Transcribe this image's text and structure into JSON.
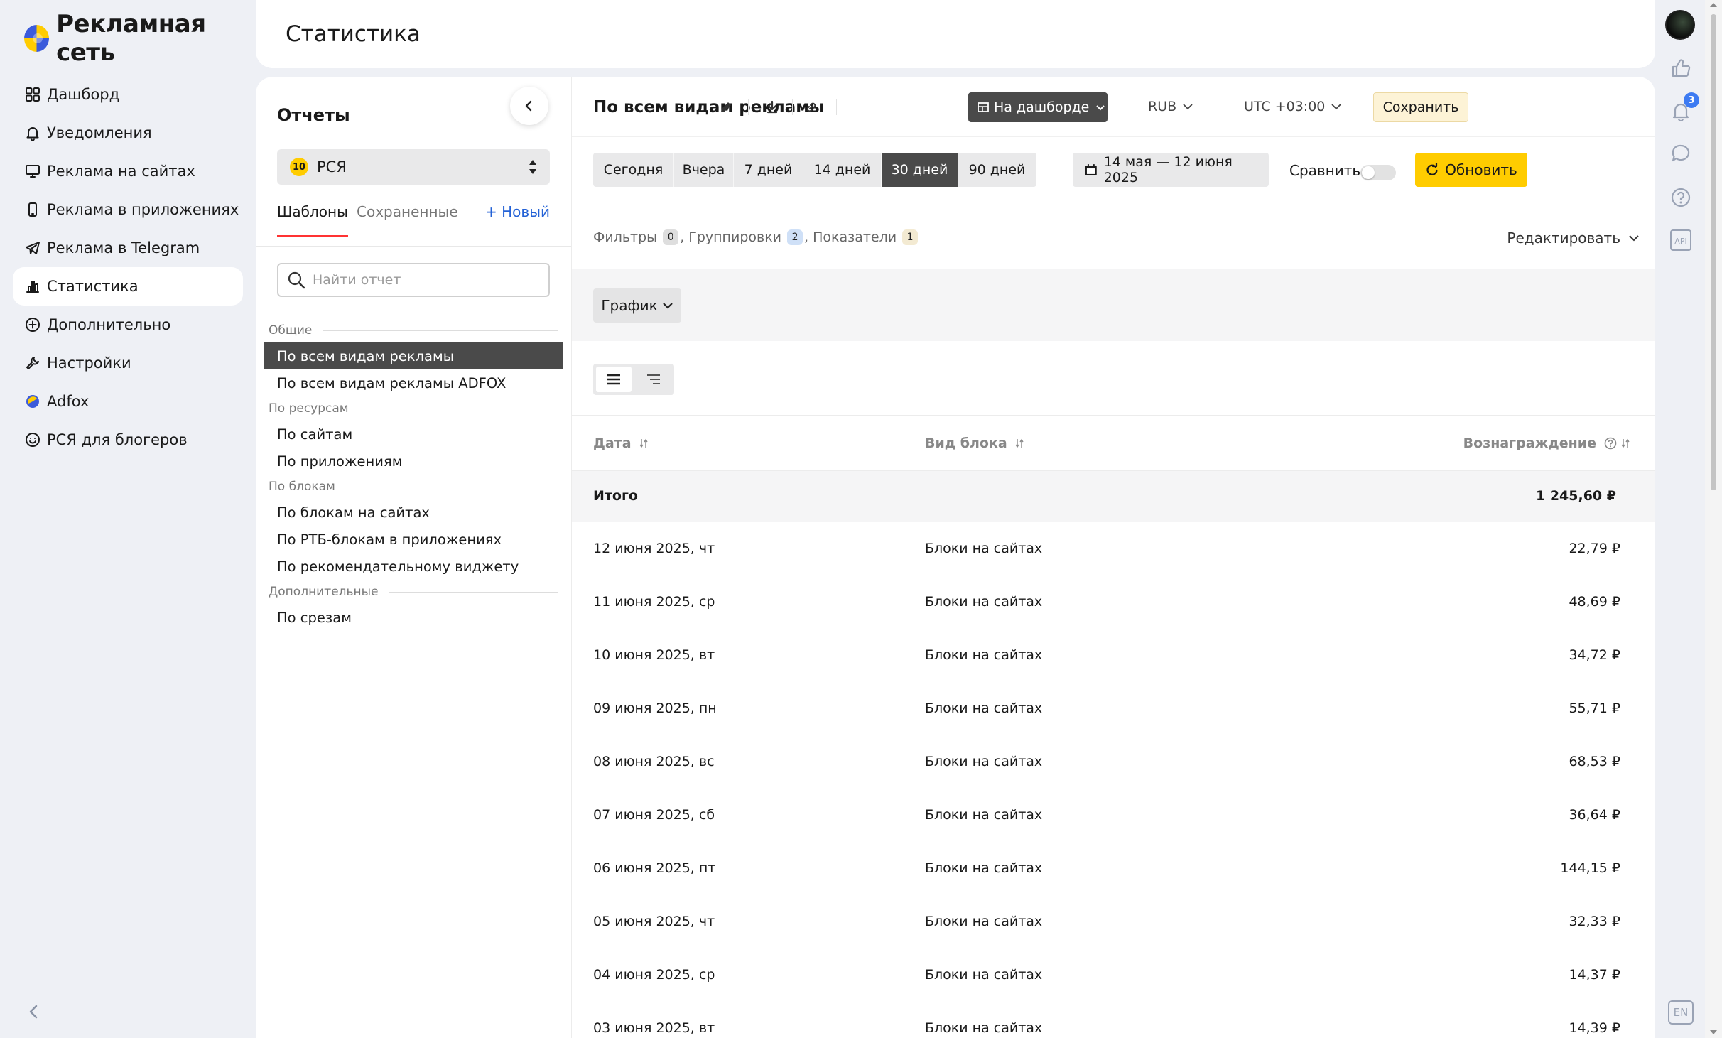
{
  "brand": {
    "name": "Рекламная сеть"
  },
  "nav": {
    "items": [
      {
        "label": "Дашборд",
        "icon": "dashboard-icon"
      },
      {
        "label": "Уведомления",
        "icon": "bell-icon"
      },
      {
        "label": "Реклама на сайтах",
        "icon": "monitor-icon"
      },
      {
        "label": "Реклама в приложениях",
        "icon": "phone-icon"
      },
      {
        "label": "Реклама в Telegram",
        "icon": "telegram-icon"
      },
      {
        "label": "Статистика",
        "icon": "chart-icon",
        "active": true
      },
      {
        "label": "Дополнительно",
        "icon": "plus-circle-icon"
      },
      {
        "label": "Настройки",
        "icon": "wrench-icon"
      },
      {
        "label": "Adfox",
        "icon": "adfox-icon"
      },
      {
        "label": "РСЯ для блогеров",
        "icon": "smile-icon"
      }
    ]
  },
  "header": {
    "title": "Статистика"
  },
  "reports": {
    "heading": "Отчеты",
    "source": {
      "badge": "10",
      "value": "РСЯ"
    },
    "tabs": {
      "templates": "Шаблоны",
      "saved": "Сохраненные",
      "new": "+ Новый"
    },
    "search_placeholder": "Найти отчет",
    "groups": [
      {
        "title": "Общие",
        "items": [
          "По всем видам рекламы",
          "По всем видам рекламы ADFOX"
        ]
      },
      {
        "title": "По ресурсам",
        "items": [
          "По сайтам",
          "По приложениям"
        ]
      },
      {
        "title": "По блокам",
        "items": [
          "По блокам на сайтах",
          "По РТБ-блокам в приложениях",
          "По рекомендательному виджету"
        ]
      },
      {
        "title": "Дополнительные",
        "items": [
          "По срезам"
        ]
      }
    ]
  },
  "main": {
    "report_title": "По всем видам рекламы",
    "dashboard_btn": "На дашборде",
    "currency": "RUB",
    "timezone": "UTC +03:00",
    "save": "Сохранить",
    "periods": [
      "Сегодня",
      "Вчера",
      "7 дней",
      "14 дней",
      "30 дней",
      "90 дней"
    ],
    "active_period": "30 дней",
    "date_range": "14 мая — 12 июня 2025",
    "compare": "Сравнить",
    "refresh": "Обновить",
    "filters": {
      "filters_label": "Фильтры",
      "filters_count": "0",
      "groupings_label": "Группировки",
      "groupings_count": "2",
      "metrics_label": "Показатели",
      "metrics_count": "1",
      "sep": ","
    },
    "edit": "Редактировать",
    "chart_btn": "График",
    "table": {
      "columns": [
        "Дата",
        "Вид блока",
        "Вознаграждение"
      ],
      "total_label": "Итого",
      "total_value": "1 245,60 ₽",
      "rows": [
        {
          "date": "12 июня 2025, чт",
          "block": "Блоки на сайтах",
          "value": "22,79 ₽"
        },
        {
          "date": "11 июня 2025, ср",
          "block": "Блоки на сайтах",
          "value": "48,69 ₽"
        },
        {
          "date": "10 июня 2025, вт",
          "block": "Блоки на сайтах",
          "value": "34,72 ₽"
        },
        {
          "date": "09 июня 2025, пн",
          "block": "Блоки на сайтах",
          "value": "55,71 ₽"
        },
        {
          "date": "08 июня 2025, вс",
          "block": "Блоки на сайтах",
          "value": "68,53 ₽"
        },
        {
          "date": "07 июня 2025, сб",
          "block": "Блоки на сайтах",
          "value": "36,64 ₽"
        },
        {
          "date": "06 июня 2025, пт",
          "block": "Блоки на сайтах",
          "value": "144,15 ₽"
        },
        {
          "date": "05 июня 2025, чт",
          "block": "Блоки на сайтах",
          "value": "32,33 ₽"
        },
        {
          "date": "04 июня 2025, ср",
          "block": "Блоки на сайтах",
          "value": "14,37 ₽"
        },
        {
          "date": "03 июня 2025, вт",
          "block": "Блоки на сайтах",
          "value": "14,39 ₽"
        }
      ]
    }
  },
  "rail": {
    "notifications_count": "3",
    "lang": "EN",
    "api_label": "API"
  },
  "colors": {
    "accent": "#ffcc00",
    "active_dark": "#4a4a4a",
    "link": "#2462d6",
    "badge_blue": "#3d7bf2"
  }
}
